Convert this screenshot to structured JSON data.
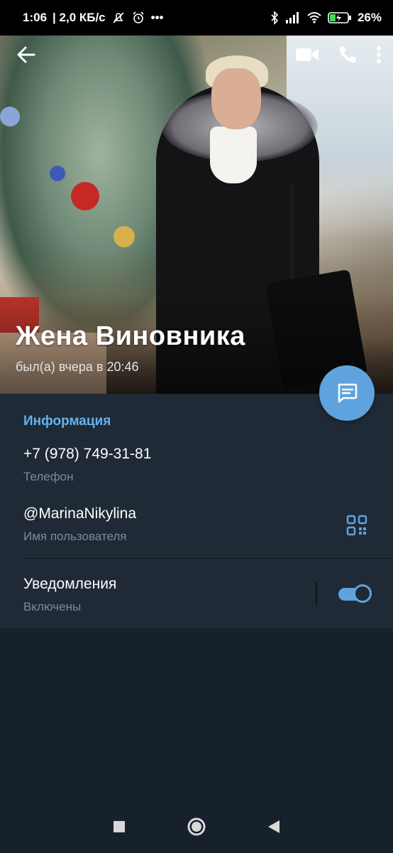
{
  "status_bar": {
    "time": "1:06",
    "network_speed": "| 2,0 КБ/с",
    "battery": "26%",
    "more": "•••"
  },
  "top_bar": {
    "back_icon": "arrow-left-icon",
    "video_icon": "video-call-icon",
    "phone_icon": "phone-call-icon",
    "menu_icon": "more-vertical-icon"
  },
  "profile": {
    "name": "Жена Виновника",
    "last_seen": "был(а) вчера в 20:46"
  },
  "info": {
    "section_title": "Информация",
    "phone_value": "+7 (978) 749-31-81",
    "phone_label": "Телефон",
    "username_value": "@MarinaNikylina",
    "username_label": "Имя пользователя",
    "notifications_title": "Уведомления",
    "notifications_state": "Включены",
    "notifications_enabled": true
  },
  "colors": {
    "accent": "#5fa3de",
    "section_title": "#64b2f0",
    "background": "#17212b",
    "card": "#1f2a36"
  }
}
